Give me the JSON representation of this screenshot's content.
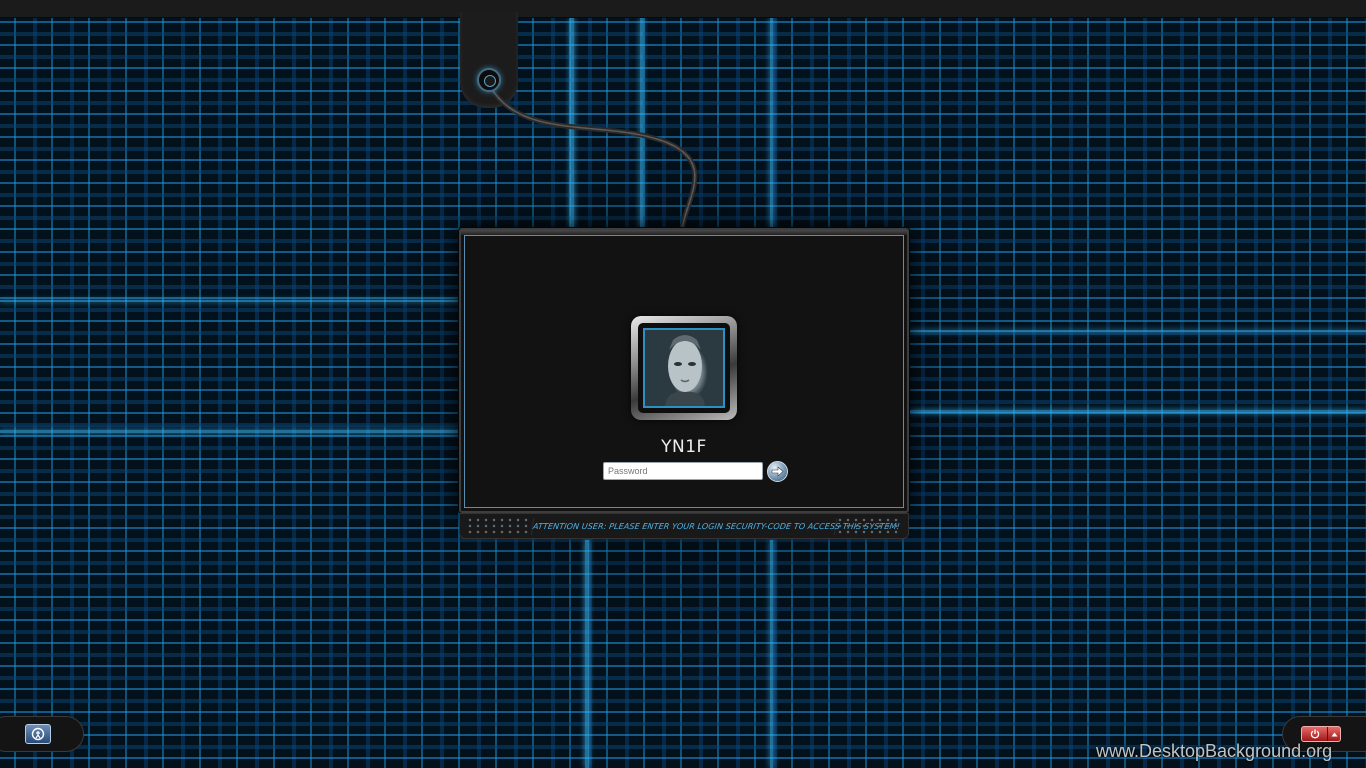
{
  "login": {
    "username": "YN1F",
    "password_placeholder": "Password",
    "submit_icon": "arrow-right-icon"
  },
  "status_strip": {
    "message": "ATTENTION USER: PLEASE ENTER YOUR LOGIN SECURITY-CODE TO ACCESS THIS SYSTEM!"
  },
  "bottom_left": {
    "icon": "ease-of-access-icon"
  },
  "bottom_right": {
    "icon": "power-icon",
    "arrow_icon": "triangle-up-icon"
  },
  "watermark": "www.DesktopBackground.org",
  "colors": {
    "accent": "#2e8fc4",
    "message": "#4fb3e8",
    "panel": "#121212",
    "power": "#c02a2a"
  }
}
